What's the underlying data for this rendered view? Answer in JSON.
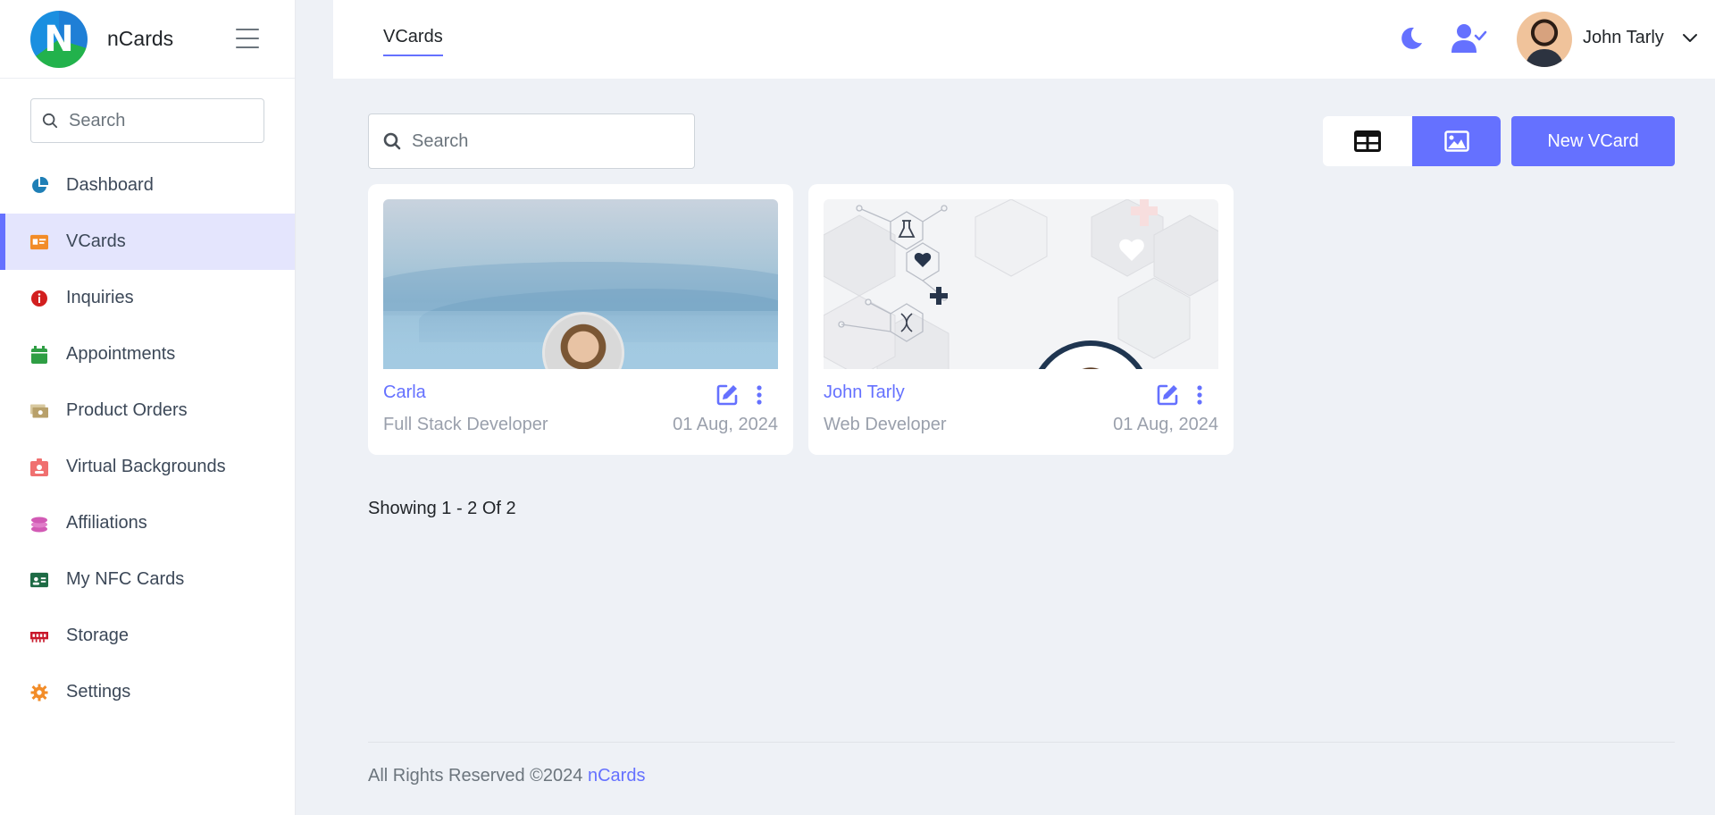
{
  "brand": {
    "name": "nCards",
    "logo_letter": "N"
  },
  "sidebar": {
    "search_placeholder": "Search",
    "items": [
      {
        "label": "Dashboard",
        "icon": "pie-chart-icon",
        "color": "#1f7fb6"
      },
      {
        "label": "VCards",
        "icon": "id-card-icon",
        "color": "#f28c28",
        "active": true
      },
      {
        "label": "Inquiries",
        "icon": "info-circle-icon",
        "color": "#d21f1f"
      },
      {
        "label": "Appointments",
        "icon": "calendar-icon",
        "color": "#2f9e44"
      },
      {
        "label": "Product Orders",
        "icon": "money-bill-icon",
        "color": "#b8a06a"
      },
      {
        "label": "Virtual Backgrounds",
        "icon": "id-badge-icon",
        "color": "#f07070"
      },
      {
        "label": "Affiliations",
        "icon": "coins-icon",
        "color": "#d25ab5"
      },
      {
        "label": "My NFC Cards",
        "icon": "contact-card-icon",
        "color": "#1e6b45"
      },
      {
        "label": "Storage",
        "icon": "memory-icon",
        "color": "#c9182b"
      },
      {
        "label": "Settings",
        "icon": "gear-icon",
        "color": "#f28c28"
      }
    ]
  },
  "header": {
    "tab": "VCards",
    "user_name": "John Tarly",
    "accent": "#6571ff"
  },
  "content": {
    "search_placeholder": "Search",
    "new_button": "New VCard",
    "cards": [
      {
        "name": "Carla",
        "title": "Full Stack Developer",
        "date": "01 Aug, 2024"
      },
      {
        "name": "John Tarly",
        "title": "Web Developer",
        "date": "01 Aug, 2024"
      }
    ],
    "showing": "Showing 1 - 2 Of 2"
  },
  "footer": {
    "text": "All Rights Reserved ©2024",
    "link": "nCards"
  }
}
